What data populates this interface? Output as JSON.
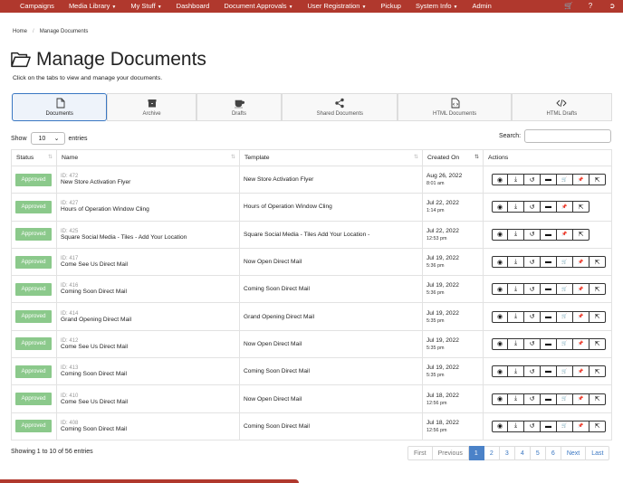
{
  "nav": {
    "items": [
      {
        "label": "Campaigns",
        "caret": false
      },
      {
        "label": "Media Library",
        "caret": true
      },
      {
        "label": "My Stuff",
        "caret": true
      },
      {
        "label": "Dashboard",
        "caret": false
      },
      {
        "label": "Document Approvals",
        "caret": true
      },
      {
        "label": "User Registration",
        "caret": true
      },
      {
        "label": "Pickup",
        "caret": false
      },
      {
        "label": "System Info",
        "caret": true
      },
      {
        "label": "Admin",
        "caret": false
      }
    ],
    "right_icons": [
      "cart-icon",
      "help-icon",
      "logout-icon"
    ],
    "bg_color": "#b0382d"
  },
  "breadcrumb": {
    "home": "Home",
    "current": "Manage Documents"
  },
  "page": {
    "title": "Manage Documents",
    "subtitle": "Click on the tabs to view and manage your documents."
  },
  "tabs": [
    {
      "label": "Documents",
      "icon": "file-icon",
      "active": true
    },
    {
      "label": "Archive",
      "icon": "archive-icon",
      "active": false
    },
    {
      "label": "Drafts",
      "icon": "coffee-icon",
      "active": false
    },
    {
      "label": "Shared Documents",
      "icon": "share-icon",
      "active": false
    },
    {
      "label": "HTML Documents",
      "icon": "file-code-icon",
      "active": false
    },
    {
      "label": "HTML Drafts",
      "icon": "code-icon",
      "active": false
    }
  ],
  "controls": {
    "show_label": "Show",
    "entries_value": "10",
    "entries_label": "entries",
    "search_label": "Search:",
    "search_value": ""
  },
  "table": {
    "columns": [
      "Status",
      "Name",
      "Template",
      "Created On",
      "Actions"
    ],
    "rows": [
      {
        "status": "Approved",
        "id": "ID: 472",
        "name": "New Store Activation Flyer",
        "template": "New Store Activation Flyer",
        "date": "Aug 26, 2022",
        "time": "8:01 am",
        "actions": [
          "view",
          "download",
          "revert",
          "archive",
          "cart",
          "pin",
          "share"
        ]
      },
      {
        "status": "Approved",
        "id": "ID: 427",
        "name": "Hours of Operation Window Cling",
        "template": "Hours of Operation Window Cling",
        "date": "Jul 22, 2022",
        "time": "1:14 pm",
        "actions": [
          "view",
          "download",
          "revert",
          "archive",
          "pin",
          "share"
        ]
      },
      {
        "status": "Approved",
        "id": "ID: 425",
        "name": "Square Social Media - Tiles - Add Your Location",
        "template": "Square Social Media - Tiles Add Your Location -",
        "date": "Jul 22, 2022",
        "time": "12:53 pm",
        "actions": [
          "view",
          "download",
          "revert",
          "archive",
          "pin",
          "share"
        ]
      },
      {
        "status": "Approved",
        "id": "ID: 417",
        "name": "Come See Us Direct Mail",
        "template": "Now Open Direct Mail",
        "date": "Jul 19, 2022",
        "time": "5:36 pm",
        "actions": [
          "view",
          "download",
          "revert",
          "archive",
          "cart",
          "pin",
          "share"
        ]
      },
      {
        "status": "Approved",
        "id": "ID: 416",
        "name": "Coming Soon Direct Mail",
        "template": "Coming Soon Direct Mail",
        "date": "Jul 19, 2022",
        "time": "5:36 pm",
        "actions": [
          "view",
          "download",
          "revert",
          "archive",
          "cart",
          "pin",
          "share"
        ]
      },
      {
        "status": "Approved",
        "id": "ID: 414",
        "name": "Grand Opening Direct Mail",
        "template": "Grand Opening Direct Mail",
        "date": "Jul 19, 2022",
        "time": "5:35 pm",
        "actions": [
          "view",
          "download",
          "revert",
          "archive",
          "cart",
          "pin",
          "share"
        ]
      },
      {
        "status": "Approved",
        "id": "ID: 412",
        "name": "Come See Us Direct Mail",
        "template": "Now Open Direct Mail",
        "date": "Jul 19, 2022",
        "time": "5:35 pm",
        "actions": [
          "view",
          "download",
          "revert",
          "archive",
          "cart",
          "pin",
          "share"
        ]
      },
      {
        "status": "Approved",
        "id": "ID: 413",
        "name": "Coming Soon Direct Mail",
        "template": "Coming Soon Direct Mail",
        "date": "Jul 19, 2022",
        "time": "5:35 pm",
        "actions": [
          "view",
          "download",
          "revert",
          "archive",
          "cart",
          "pin",
          "share"
        ]
      },
      {
        "status": "Approved",
        "id": "ID: 410",
        "name": "Come See Us Direct Mail",
        "template": "Now Open Direct Mail",
        "date": "Jul 18, 2022",
        "time": "12:56 pm",
        "actions": [
          "view",
          "download",
          "revert",
          "archive",
          "cart",
          "pin",
          "share"
        ]
      },
      {
        "status": "Approved",
        "id": "ID: 408",
        "name": "Coming Soon Direct Mail",
        "template": "Coming Soon Direct Mail",
        "date": "Jul 18, 2022",
        "time": "12:56 pm",
        "actions": [
          "view",
          "download",
          "revert",
          "archive",
          "cart",
          "pin",
          "share"
        ]
      }
    ]
  },
  "footer": {
    "info": "Showing 1 to 10 of 56 entries",
    "pager": {
      "first": "First",
      "previous": "Previous",
      "pages": [
        "1",
        "2",
        "3",
        "4",
        "5",
        "6"
      ],
      "current": "1",
      "next": "Next",
      "last": "Last"
    }
  }
}
